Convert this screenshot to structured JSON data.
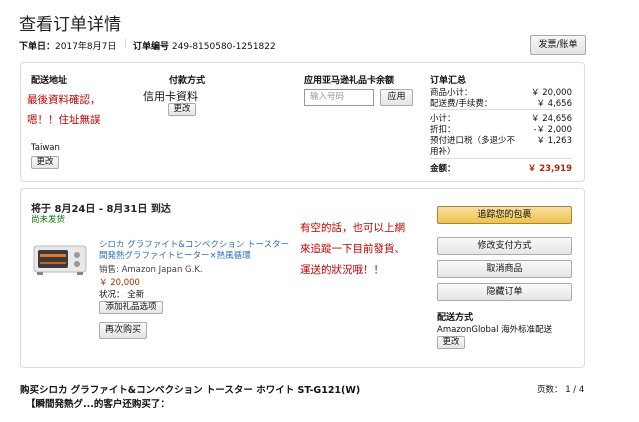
{
  "page": {
    "title": "查看订单详情"
  },
  "order": {
    "date_label": "下单日：",
    "date": "2017年8月7日",
    "number_label": "订单编号",
    "number": "249-8150580-1251822",
    "invoice_btn": "发票/账单"
  },
  "shipping": {
    "heading": "配送地址",
    "annotation": [
      "最後資料確認，",
      "嗯！！住址無誤"
    ],
    "country": "Taiwan",
    "change_btn": "更改"
  },
  "payment": {
    "heading": "付款方式",
    "annotation": "信用卡資料",
    "change_btn": "更改"
  },
  "giftcard": {
    "heading": "应用亚马逊礼品卡余额",
    "placeholder": "输入号码",
    "apply_btn": "应用"
  },
  "summary": {
    "heading": "订单汇总",
    "rows": [
      {
        "label": "商品小计：",
        "value": "￥ 20,000"
      },
      {
        "label": "配送费/手续费：",
        "value": "￥ 4,656"
      },
      {
        "label": "小计：",
        "value": "￥ 24,656"
      },
      {
        "label": "折扣：",
        "value": "-￥ 2,000"
      },
      {
        "label": "预付进口税（多退少不",
        "value": "￥ 1,263"
      },
      {
        "label": "用补）",
        "value": ""
      }
    ],
    "total_label": "金额：",
    "total_value": "￥ 23,919"
  },
  "shipment": {
    "delivery": "将于 8月24日 - 8月31日 到达",
    "status": "尚未发货",
    "item_title_line1": "シロカ グラファイト&コンベクション トースター",
    "item_title_line2": "間発熱グラファイトヒーター×熱風循環",
    "seller": "销售: Amazon Japan G.K.",
    "price": "￥ 20,000",
    "condition": "状况： 全新",
    "gift_btn": "添加礼品选项",
    "rebuy_btn": "再次购买",
    "annotation": [
      "有空的話，也可以上網",
      "來追蹤一下目前發貨、",
      "運送的狀況哦！！"
    ],
    "track_btn": "追踪您的包裹",
    "actions": [
      "修改支付方式",
      "取消商品",
      "隐藏订单"
    ],
    "ship_method_heading": "配送方式",
    "ship_method": "AmazonGlobal 海外标准配送",
    "ship_change_btn": "更改"
  },
  "footer": {
    "heading": "购买シロカ グラファイト&コンベクション トースター ホワイト ST-G121(W)",
    "subheading": "【瞬間発熱グ...的客户还购买了：",
    "page_label": "页数： 1 / 4"
  },
  "colors": {
    "accent_button": "#f0c14b",
    "annotation_red": "#c00000",
    "link": "#2a6fb8",
    "price": "#b12704"
  }
}
